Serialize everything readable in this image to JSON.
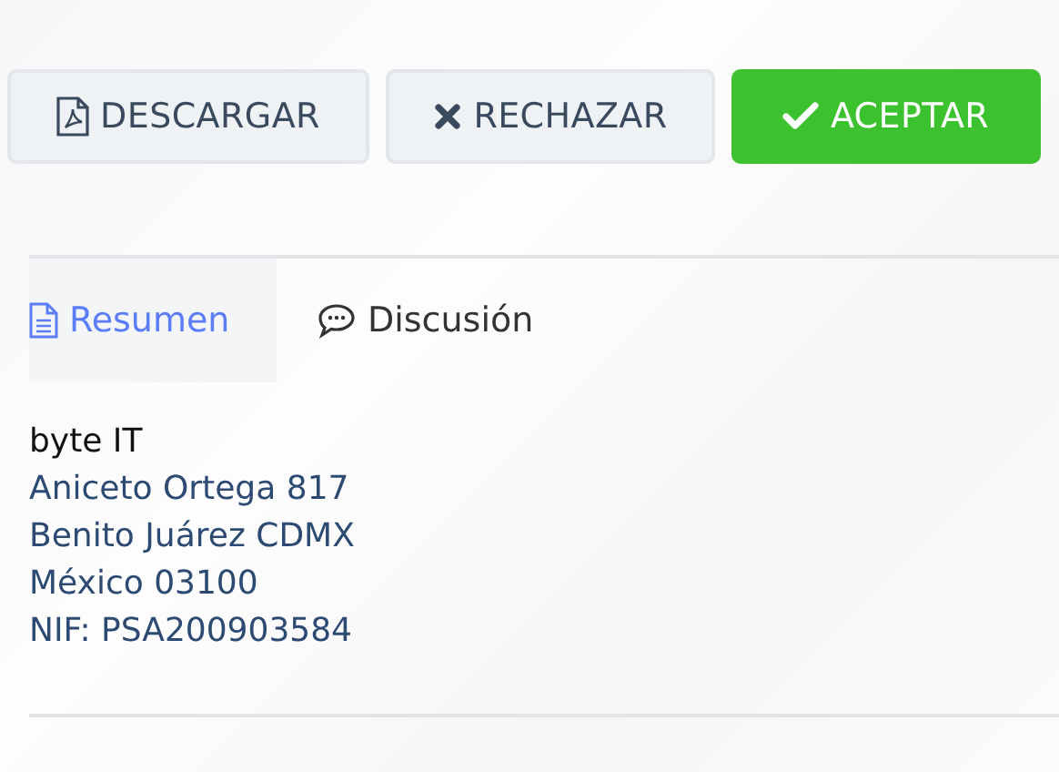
{
  "actions": [
    {
      "label": "DESCARGAR",
      "kind": "pdf",
      "primary": false
    },
    {
      "label": "RECHAZAR",
      "kind": "reject",
      "primary": false
    },
    {
      "label": "ACEPTAR",
      "kind": "accept",
      "primary": true
    }
  ],
  "tabs": [
    {
      "label": "Resumen",
      "kind": "document",
      "selected": true
    },
    {
      "label": "Discusión",
      "kind": "chat",
      "selected": false
    }
  ],
  "summary": {
    "company": "byte IT",
    "address_lines": [
      "Aniceto Ortega 817",
      "Benito Juárez CDMX",
      "México 03100",
      "NIF: PSA200903584"
    ]
  }
}
